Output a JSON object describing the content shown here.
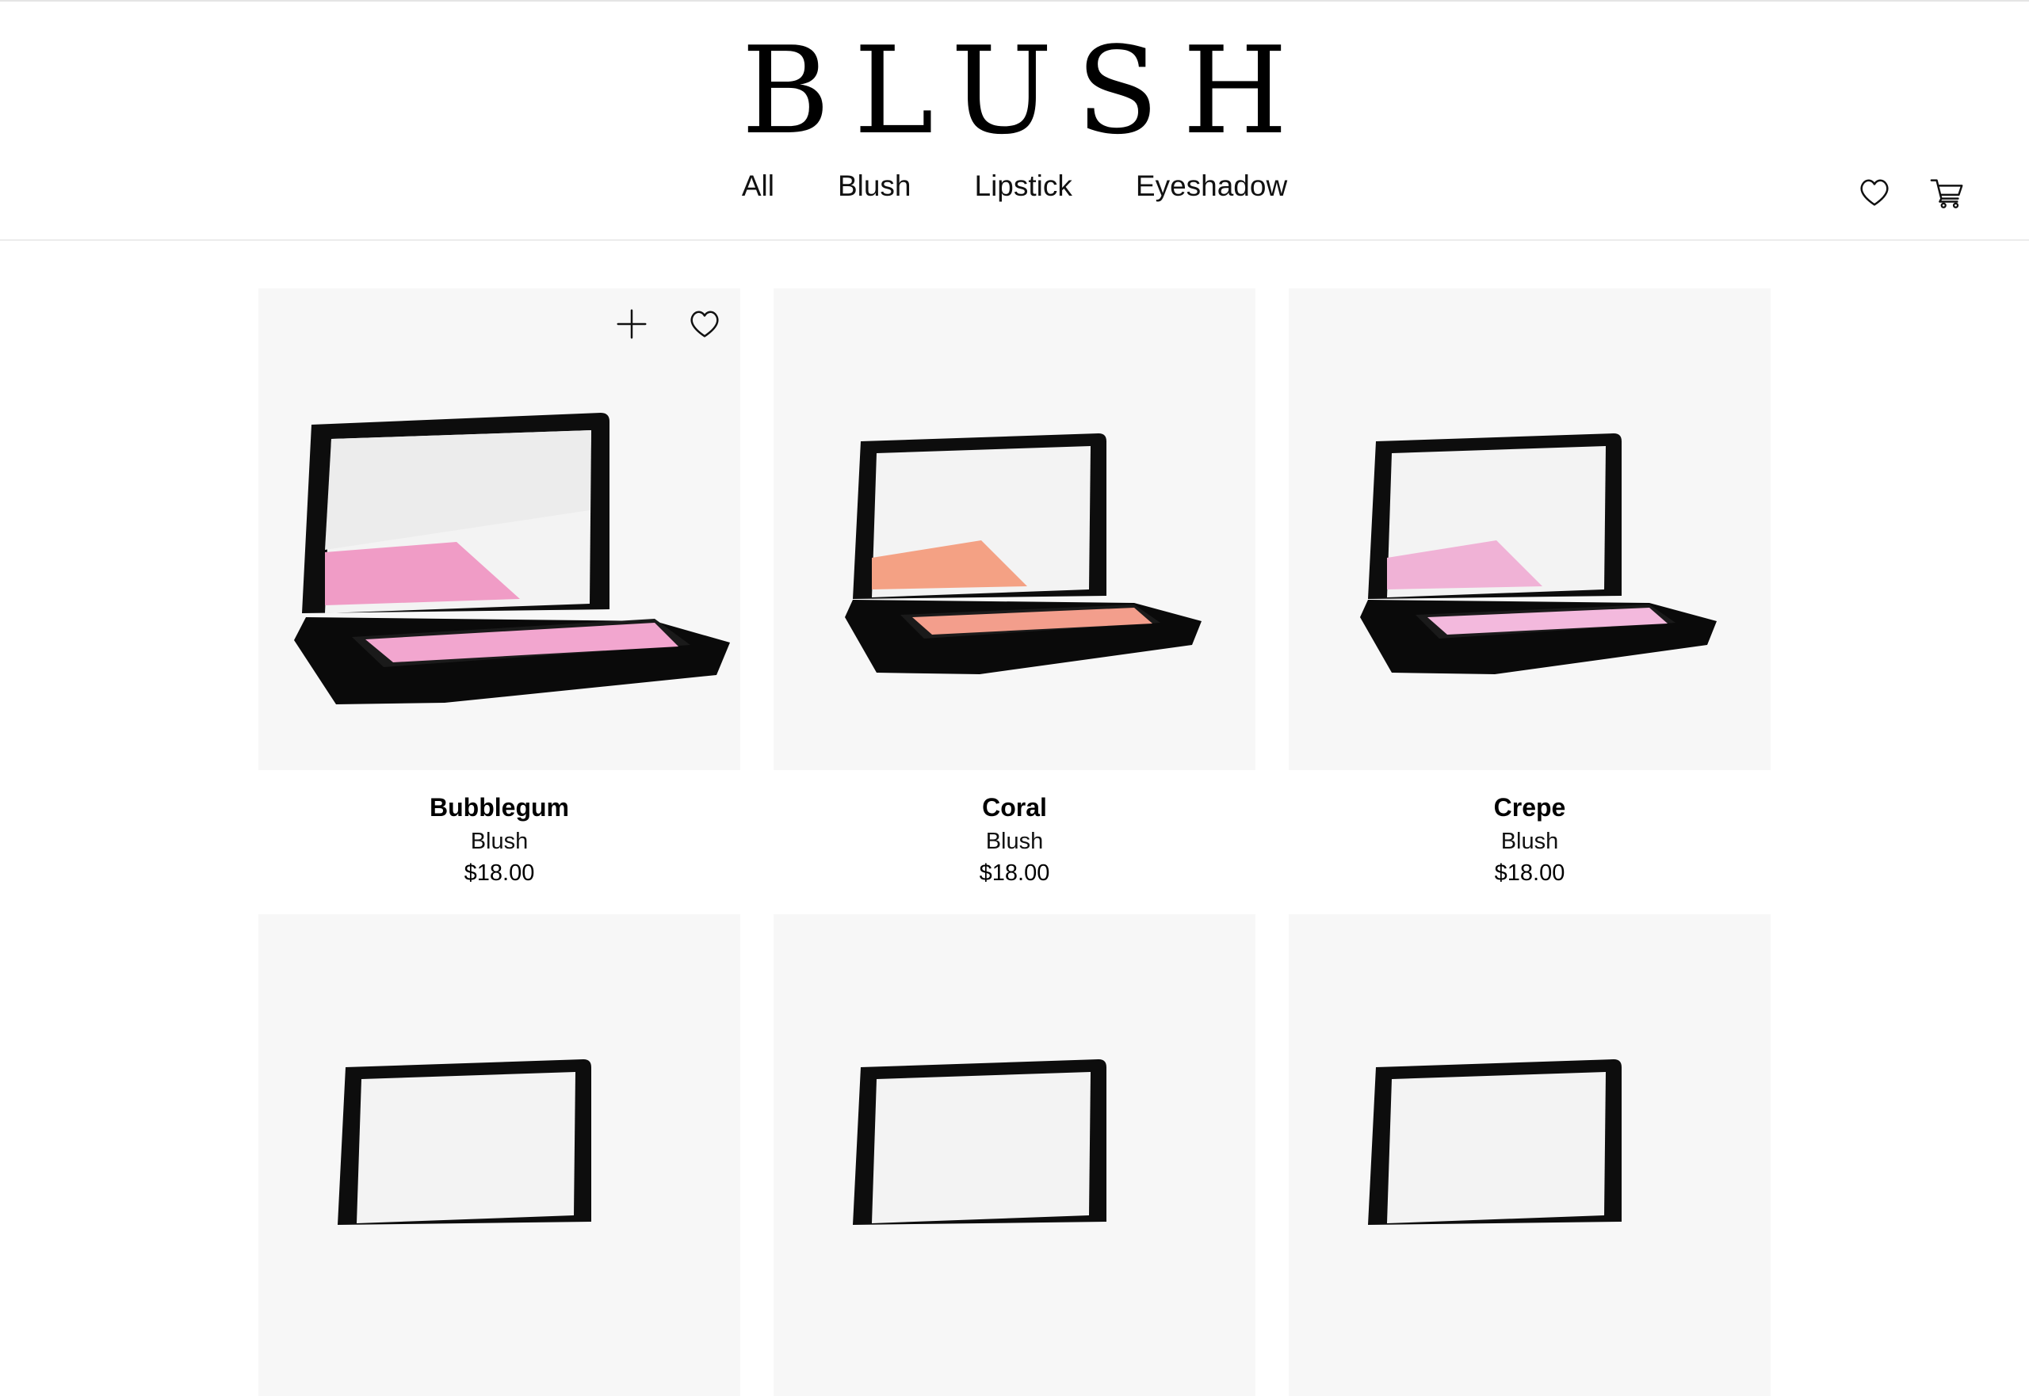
{
  "brand": {
    "logo": "BLUSH"
  },
  "nav": {
    "items": [
      {
        "label": "All"
      },
      {
        "label": "Blush"
      },
      {
        "label": "Lipstick"
      },
      {
        "label": "Eyeshadow"
      }
    ]
  },
  "header_icons": [
    "heart-icon",
    "cart-icon"
  ],
  "products": [
    {
      "name": "Bubblegum",
      "category": "Blush",
      "price": "$18.00",
      "pan_color": "#f09cc6",
      "pan_color_lower": "#f2a6cf"
    },
    {
      "name": "Coral",
      "category": "Blush",
      "price": "$18.00",
      "pan_color": "#f4a184",
      "pan_color_lower": "#f39e8c"
    },
    {
      "name": "Crepe",
      "category": "Blush",
      "price": "$18.00",
      "pan_color": "#f0b2d6",
      "pan_color_lower": "#f3b9dd"
    },
    {
      "name": "",
      "category": "",
      "price": ""
    },
    {
      "name": "",
      "category": "",
      "price": ""
    },
    {
      "name": "",
      "category": "",
      "price": ""
    }
  ],
  "card_actions": [
    "plus-icon",
    "heart-icon"
  ],
  "colors": {
    "background": "#ffffff",
    "card_bg": "#f7f7f7",
    "text": "#000000",
    "divider": "#ececec"
  }
}
